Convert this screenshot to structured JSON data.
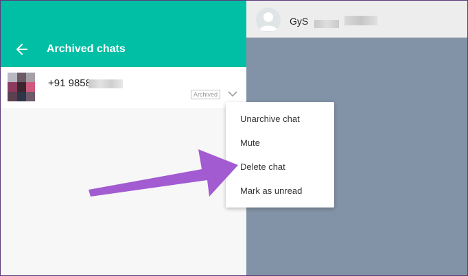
{
  "left_panel": {
    "header": {
      "title": "Archived chats",
      "back_icon": "arrow-left-icon"
    },
    "chat": {
      "name": "+91 9858",
      "badge": "Archived",
      "menu_icon": "chevron-down-icon"
    }
  },
  "right_panel": {
    "contact": {
      "name": "GyS"
    }
  },
  "context_menu": {
    "items": [
      {
        "label": "Unarchive chat"
      },
      {
        "label": "Mute"
      },
      {
        "label": "Delete chat"
      },
      {
        "label": "Mark as unread"
      }
    ]
  },
  "colors": {
    "header_accent": "#00bfa5",
    "chat_background": "#8393a7",
    "annotation_arrow": "#a25bd0"
  }
}
